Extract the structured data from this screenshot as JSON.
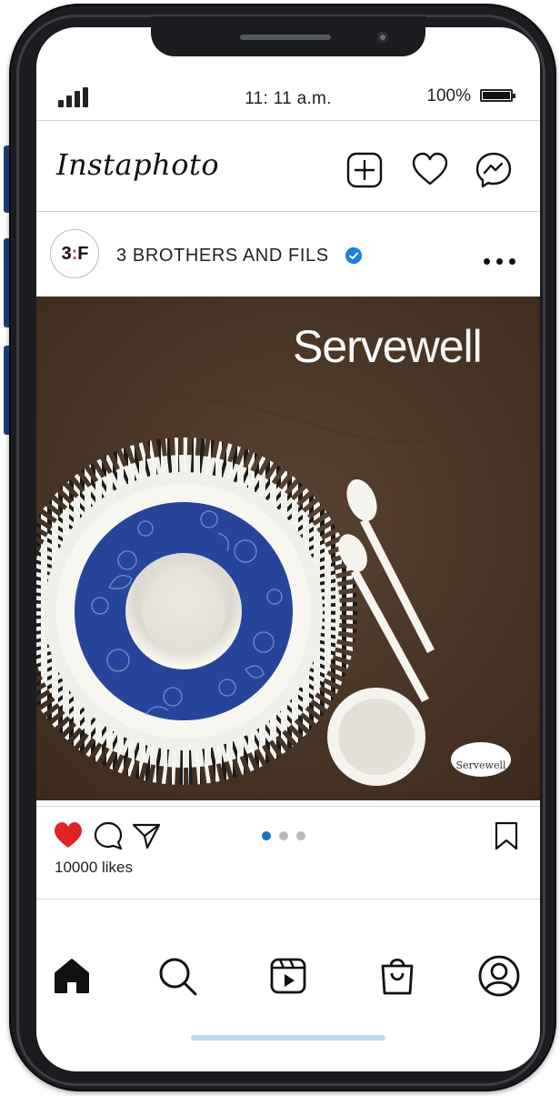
{
  "status_bar": {
    "time": "11: 11 a.m.",
    "battery_percent": "100%",
    "signal_icon": "signal-bars-icon",
    "battery_icon": "battery-full-icon"
  },
  "app": {
    "title": "Instaphoto",
    "header_icons": [
      "new-post-icon",
      "heart-icon",
      "messenger-icon"
    ]
  },
  "post": {
    "account_name": "3 BROTHERS AND FILS",
    "avatar_text_left": "3",
    "avatar_text_colon": ":",
    "avatar_text_right": "F",
    "verified": true,
    "verified_color": "#1e7fdc",
    "image": {
      "brand_text_bold": "Serve",
      "brand_text_thin": "well",
      "small_logo_text": "Servewell",
      "background_color": "#4b3624",
      "plate_pattern_color": "#23449e"
    },
    "liked": true,
    "like_color": "#e02424",
    "likes_text": "10000 likes",
    "carousel": {
      "count": 3,
      "active_index": 0,
      "active_color": "#1f6fbf"
    }
  },
  "bottom_nav": {
    "items": [
      "home-icon",
      "search-icon",
      "reels-icon",
      "shop-icon",
      "profile-icon"
    ]
  }
}
